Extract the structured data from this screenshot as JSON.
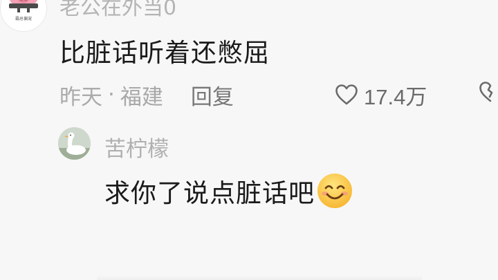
{
  "top_comment": {
    "username": "老公在外当0",
    "avatar_caption": "霸总偏宠",
    "text": "比脏话听着还憋屈",
    "time": "昨天",
    "separator": "·",
    "location": "福建",
    "reply_label": "回复",
    "like_count": "17.4万",
    "like_icon": "heart-outline-icon",
    "dislike_icon": "broken-heart-icon"
  },
  "reply": {
    "username": "苦柠檬",
    "avatar_icon": "goose-avatar",
    "text": "求你了说点脏话吧",
    "emoji": "smiling-face-emoji"
  },
  "colors": {
    "background": "#f7f7f7",
    "primary_text": "#1a1a1a",
    "secondary_text": "#a8a8a8",
    "username_text": "#b0b0b0",
    "pig_pink": "#f2a0b4"
  }
}
